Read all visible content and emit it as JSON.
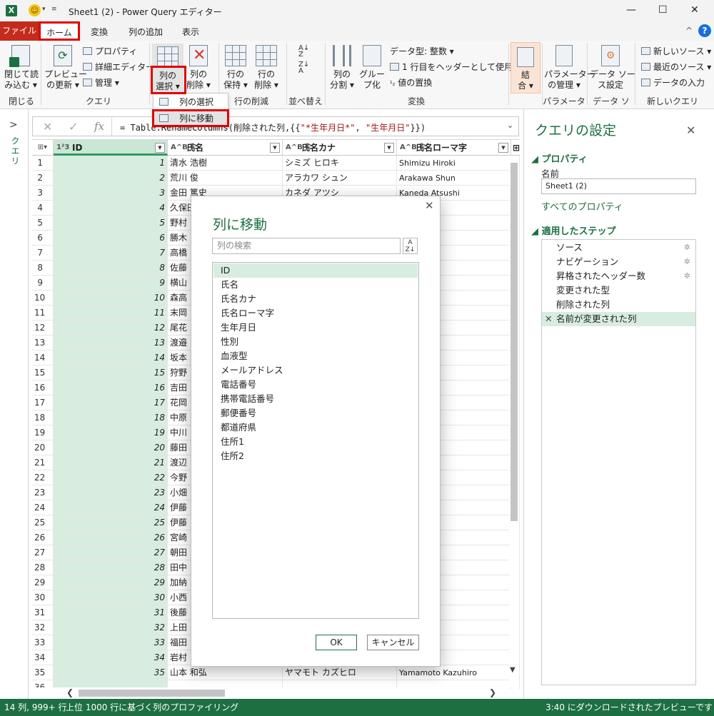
{
  "window": {
    "title": "Sheet1 (2) - Power Query エディター",
    "minimize": "—",
    "maximize": "☐",
    "close": "✕"
  },
  "tabs": {
    "file": "ファイル",
    "home": "ホーム",
    "transform": "変換",
    "add_column": "列の追加",
    "view": "表示",
    "collapse": "^",
    "help": "?"
  },
  "ribbon": {
    "close_load": "閉じて読\nみ込む ▾",
    "close_group": "閉じる",
    "refresh_preview": "プレビュー\nの更新 ▾",
    "properties": "プロパティ",
    "advanced_editor": "詳細エディター",
    "manage": "管理 ▾",
    "query_group": "クエリ",
    "choose_columns": "列の\n選択 ▾",
    "remove_columns": "列の\n削除 ▾",
    "keep_rows": "行の\n保持 ▾",
    "remove_rows": "行の\n削除 ▾",
    "reduce_rows_group": "行の削減",
    "sort_group": "並べ替え",
    "split_column": "列の\n分割 ▾",
    "group_by": "グルー\nプ化",
    "data_type": "データ型: 整数 ▾",
    "use_first_row": "1 行目をヘッダーとして使用 ▾",
    "replace_values": "値の置換",
    "transform_group": "変換",
    "combine": "結\n合 ▾",
    "manage_params": "パラメーター\nの管理 ▾",
    "params_group": "パラメーター",
    "data_source_settings": "データ ソー\nス設定",
    "data_sources_group": "データ ソース",
    "new_source": "新しいソース ▾",
    "recent_sources": "最近のソース ▾",
    "enter_data": "データの入力",
    "new_query_group": "新しいクエリ"
  },
  "dropdown": {
    "choose_columns": "列の選択",
    "go_to_column": "列に移動"
  },
  "left_nav": {
    "chevron": ">",
    "label": "クエリ"
  },
  "formula": {
    "cancel": "✕",
    "commit": "✓",
    "fx": "fx",
    "prefix": "= Table.RenameColumns(削除された列,{{",
    "str1": "\"*生年月日*\"",
    "comma": ", ",
    "str2": "\"生年月日\"",
    "suffix": "}})",
    "expand": "⌄"
  },
  "grid": {
    "columns": [
      {
        "type": "1²3",
        "name": "ID"
      },
      {
        "type": "A^B_C",
        "name": "氏名"
      },
      {
        "type": "A^B_C",
        "name": "氏名カナ"
      },
      {
        "type": "A^B_C",
        "name": "氏名ローマ字"
      },
      {
        "type": "",
        "name": "⊞"
      }
    ],
    "rows": [
      [
        "1",
        "1",
        "清水 浩樹",
        "シミズ ヒロキ",
        "Shimizu Hiroki"
      ],
      [
        "2",
        "2",
        "荒川 俊",
        "アラカワ シュン",
        "Arakawa Shun"
      ],
      [
        "3",
        "3",
        "金田 篤史",
        "カネダ アツシ",
        "Kaneda Atsushi"
      ],
      [
        "4",
        "4",
        "久保田",
        "",
        "shi"
      ],
      [
        "5",
        "5",
        "野村",
        "",
        "nichi"
      ],
      [
        "6",
        "6",
        "勝木",
        "",
        "nsuke"
      ],
      [
        "7",
        "7",
        "高橋",
        "",
        "akuya"
      ],
      [
        "8",
        "8",
        "佐藤",
        "",
        ""
      ],
      [
        "9",
        "9",
        "横山",
        "",
        "sukasa"
      ],
      [
        "10",
        "10",
        "森高",
        "",
        "wa"
      ],
      [
        "11",
        "11",
        "末岡",
        "",
        "shi"
      ],
      [
        "12",
        "12",
        "尾花",
        "",
        "o"
      ],
      [
        "13",
        "13",
        "渡邉",
        "",
        "youhei"
      ],
      [
        "14",
        "14",
        "坂本",
        "",
        "etsuya"
      ],
      [
        "15",
        "15",
        "狩野",
        "",
        ""
      ],
      [
        "16",
        "16",
        "吉田",
        "",
        "sahiko"
      ],
      [
        "17",
        "17",
        "花岡",
        "",
        "uko"
      ],
      [
        "18",
        "18",
        "中原",
        "",
        "hie"
      ],
      [
        "19",
        "19",
        "中川",
        "",
        "ya"
      ],
      [
        "20",
        "20",
        "藤田",
        "",
        "hiro"
      ],
      [
        "21",
        "21",
        "渡辺",
        "",
        "akako"
      ],
      [
        "22",
        "22",
        "今野",
        "",
        ""
      ],
      [
        "23",
        "23",
        "小畑",
        "",
        ""
      ],
      [
        "24",
        "24",
        "伊藤",
        "",
        "o"
      ],
      [
        "25",
        "25",
        "伊藤",
        "",
        ""
      ],
      [
        "26",
        "26",
        "宮崎",
        "",
        "uki"
      ],
      [
        "27",
        "27",
        "朝田",
        "",
        ""
      ],
      [
        "28",
        "28",
        "田中",
        "",
        "ahiko"
      ],
      [
        "29",
        "29",
        "加納",
        "",
        "oto"
      ],
      [
        "30",
        "30",
        "小西",
        "",
        "uhei"
      ],
      [
        "31",
        "31",
        "後藤",
        "",
        "iro"
      ],
      [
        "32",
        "32",
        "上田",
        "",
        ""
      ],
      [
        "33",
        "33",
        "福田",
        "",
        "ko"
      ],
      [
        "34",
        "34",
        "岩村",
        "",
        "monobu"
      ],
      [
        "35",
        "35",
        "山本 和弘",
        "ヤマモト カズヒロ",
        "Yamamoto Kazuhiro"
      ],
      [
        "36",
        "",
        "",
        "",
        ""
      ]
    ]
  },
  "settings": {
    "title": "クエリの設定",
    "close": "✕",
    "properties_header": "◢ プロパティ",
    "name_label": "名前",
    "name_value": "Sheet1 (2)",
    "all_properties": "すべてのプロパティ",
    "steps_header": "◢ 適用したステップ",
    "steps": [
      {
        "label": "ソース",
        "gear": true,
        "active": false
      },
      {
        "label": "ナビゲーション",
        "gear": true,
        "active": false
      },
      {
        "label": "昇格されたヘッダー数",
        "gear": true,
        "active": false
      },
      {
        "label": "変更された型",
        "gear": false,
        "active": false
      },
      {
        "label": "削除された列",
        "gear": false,
        "active": false
      },
      {
        "label": "名前が変更された列",
        "gear": false,
        "active": true
      }
    ]
  },
  "dialog": {
    "title": "列に移動",
    "close": "✕",
    "search_placeholder": "列の検索",
    "sort_icon": "A↓Z",
    "columns": [
      "ID",
      "氏名",
      "氏名カナ",
      "氏名ローマ字",
      "生年月日",
      "性別",
      "血液型",
      "メールアドレス",
      "電話番号",
      "携帯電話番号",
      "郵便番号",
      "都道府県",
      "住所1",
      "住所2"
    ],
    "selected": "ID",
    "ok": "OK",
    "cancel": "キャンセル"
  },
  "status": {
    "left": "14 列, 999+ 行",
    "profiling": "上位 1000 行に基づく列のプロファイリング",
    "right": "3:40 にダウンロードされたプレビューです"
  },
  "colors": {
    "accent_green": "#1d6f42",
    "selected_green": "#d7ede0",
    "file_tab_red": "#c42b1c",
    "highlight_red": "#e00000"
  }
}
